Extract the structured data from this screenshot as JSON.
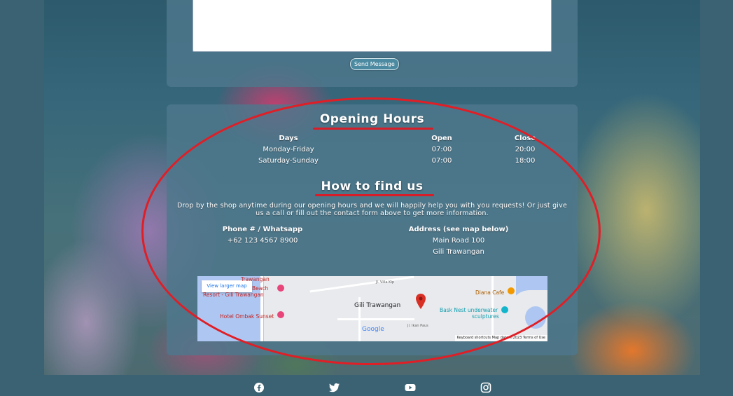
{
  "contact": {
    "send_label": "Send Message"
  },
  "hours": {
    "title": "Opening Hours",
    "headers": [
      "Days",
      "Open",
      "Close"
    ],
    "rows": [
      {
        "days": "Monday-Friday",
        "open": "07:00",
        "close": "20:00"
      },
      {
        "days": "Saturday-Sunday",
        "open": "07:00",
        "close": "18:00"
      }
    ]
  },
  "find": {
    "title": "How to find us",
    "description": "Drop by the shop anytime during our opening hours and we will happily help you with you requests! Or just give us a call or fill out the contact form above to get more information.",
    "phone_label": "Phone # / Whatsapp",
    "phone": "+62 123 4567 8900",
    "address_label": "Address (see map below)",
    "address_line1": "Main Road 100",
    "address_line2": "Gili Trawangan"
  },
  "map": {
    "view_larger": "View larger map",
    "place_main": "Gili Trawangan",
    "poi_1": "Beach",
    "poi_1b": "Resort - Gili Trawangan",
    "poi_2": "Hotel Ombak Sunset",
    "poi_3": "Diana Cafe",
    "poi_4a": "Bask Nest underwater",
    "poi_4b": "sculptures",
    "poi_top": "Trawangan",
    "street_1": "Jl. Villa Kip",
    "street_2": "Jl. Ikan Paus",
    "brand": "Google",
    "footer": "Keyboard shortcuts   Map data ©2023   Terms of Use",
    "colors": {
      "water": "#aec7f2",
      "land": "#e8eaed",
      "pin": "#d93025"
    }
  },
  "social": {
    "icons": [
      "facebook-icon",
      "twitter-icon",
      "youtube-icon",
      "instagram-icon"
    ]
  },
  "theme": {
    "accent": "#d81d28",
    "panel": "#4e788c",
    "page_bg": "#3a6272"
  }
}
